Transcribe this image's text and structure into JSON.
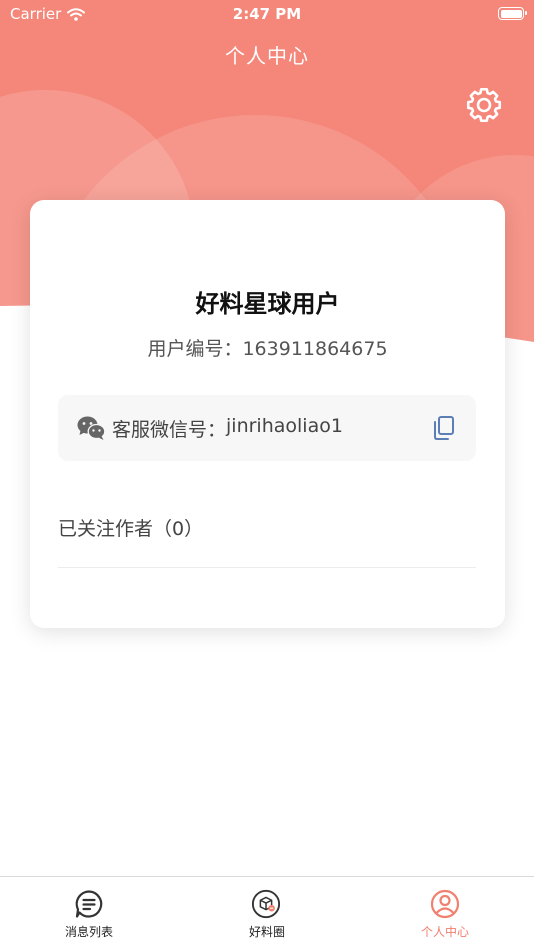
{
  "status_bar": {
    "carrier": "Carrier",
    "time": "2:47 PM"
  },
  "header": {
    "title": "个人中心",
    "settings_icon": "gear-icon"
  },
  "profile": {
    "username": "好料星球用户",
    "user_id_label": "用户编号：",
    "user_id": "163911864675"
  },
  "customer_service": {
    "label": "客服微信号：",
    "wechat_id": "jinrihaoliao1",
    "icon": "wechat-icon",
    "copy_icon": "copy-icon"
  },
  "following": {
    "label": "已关注作者",
    "count": "（0）"
  },
  "tab_bar": {
    "tabs": [
      {
        "label": "消息列表",
        "icon": "message-list-icon",
        "active": false
      },
      {
        "label": "好料圈",
        "icon": "box-circle-icon",
        "active": false
      },
      {
        "label": "个人中心",
        "icon": "user-circle-icon",
        "active": true
      }
    ]
  },
  "colors": {
    "accent": "#f0806f",
    "header_bg": "#f5877a",
    "card_bg": "#ffffff",
    "inactive_text": "#222222"
  }
}
